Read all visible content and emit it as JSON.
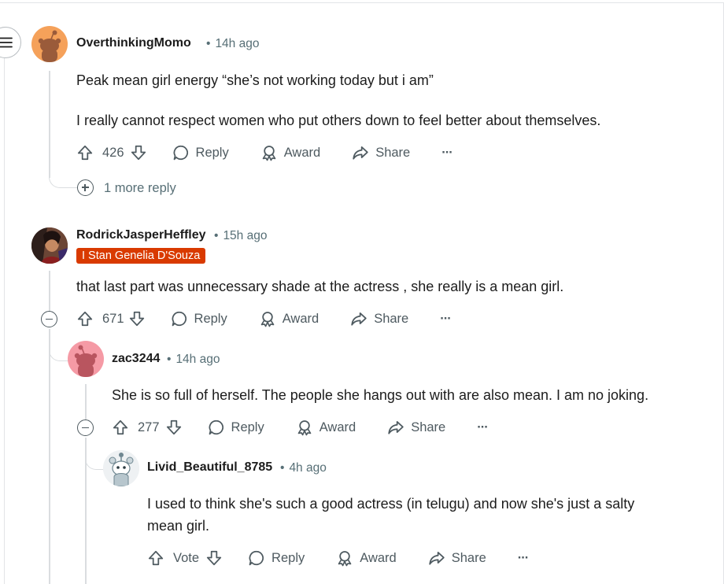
{
  "comments": [
    {
      "author": "OverthinkingMomo",
      "time": "14h ago",
      "body": [
        "Peak mean girl energy “she’s not working today but i am”",
        "I really cannot respect women who put others down to feel better about themselves."
      ],
      "votes": "426",
      "more_replies": "1 more reply",
      "avatar_icon": "orange-snoo-avatar"
    },
    {
      "author": "RodrickJasperHeffley",
      "time": "15h ago",
      "flair": "I Stan Genelia D'Souza",
      "body": [
        "that last part was unnecessary shade at the actress , she really is a mean girl."
      ],
      "votes": "671",
      "avatar_icon": "photo-avatar"
    },
    {
      "author": "zac3244",
      "time": "14h ago",
      "body": [
        "She is so full of herself. The people she hangs out with are also mean. I am no joking."
      ],
      "votes": "277",
      "avatar_icon": "pink-snoo-avatar"
    },
    {
      "author": "Livid_Beautiful_8785",
      "time": "4h ago",
      "body": [
        "I used to think she's such a good actress (in telugu) and now she's just a salty",
        "mean girl."
      ],
      "votes": "Vote",
      "avatar_icon": "custom-snoo-avatar"
    }
  ],
  "actions": {
    "reply": "Reply",
    "award": "Award",
    "share": "Share",
    "overflow": "···"
  },
  "colors": {
    "flair_bg": "#d93a00",
    "meta": "#576f76",
    "action": "#4e5a60",
    "thread": "#dadde0"
  }
}
